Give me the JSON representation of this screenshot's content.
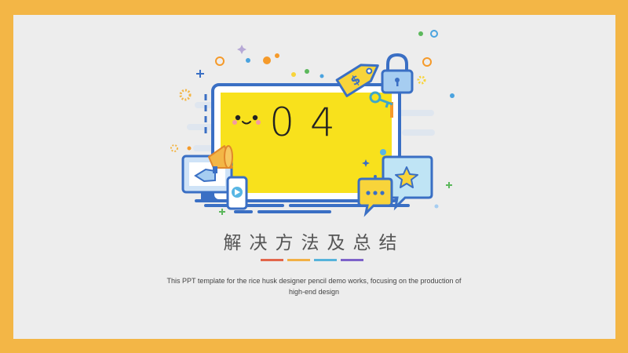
{
  "slide": {
    "number": "04",
    "title": "解决方法及总结",
    "description_line1": "This PPT template for the rice husk designer pencil demo works, focusing on the production of",
    "description_line2": "high-end design",
    "accent_bars": [
      "#e2664a",
      "#f2b045",
      "#56b3db",
      "#7d62c9"
    ]
  },
  "colors": {
    "frame": "#f3b646",
    "background": "#ededed",
    "screen_fill": "#f8e11c",
    "outline": "#3a6fc4"
  },
  "icons": [
    "smiley-face",
    "price-tag-icon",
    "padlock-icon",
    "key-icon",
    "megaphone-icon",
    "monitor-icon",
    "phone-video-icon",
    "chat-bubble-icon",
    "star-bubble-icon"
  ]
}
